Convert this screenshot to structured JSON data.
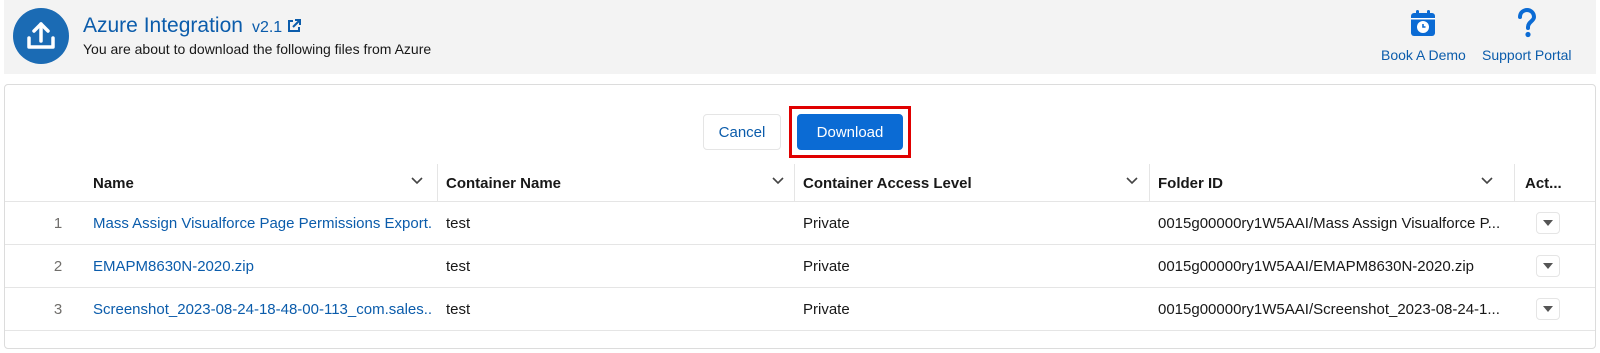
{
  "header": {
    "title": "Azure Integration",
    "version": "v2.1",
    "subtitle": "You are about to download the following files from Azure",
    "actions": [
      {
        "label": "Book A Demo",
        "icon": "calendar-clock-icon"
      },
      {
        "label": "Support Portal",
        "icon": "question-icon"
      }
    ]
  },
  "buttons": {
    "cancel": "Cancel",
    "download": "Download"
  },
  "table": {
    "columns": [
      "Name",
      "Container Name",
      "Container Access Level",
      "Folder ID",
      "Act..."
    ],
    "rows": [
      {
        "num": "1",
        "name": "Mass Assign Visualforce Page Permissions Export...",
        "container": "test",
        "access": "Private",
        "folder": "0015g00000ry1W5AAI/Mass Assign Visualforce P..."
      },
      {
        "num": "2",
        "name": "EMAPM8630N-2020.zip",
        "container": "test",
        "access": "Private",
        "folder": "0015g00000ry1W5AAI/EMAPM8630N-2020.zip"
      },
      {
        "num": "3",
        "name": "Screenshot_2023-08-24-18-48-00-113_com.sales...",
        "container": "test",
        "access": "Private",
        "folder": "0015g00000ry1W5AAI/Screenshot_2023-08-24-1..."
      }
    ]
  },
  "colors": {
    "brand": "#0b5cab",
    "button": "#0b6bd4",
    "highlight": "#e00000",
    "header_bg": "#f3f3f3"
  }
}
